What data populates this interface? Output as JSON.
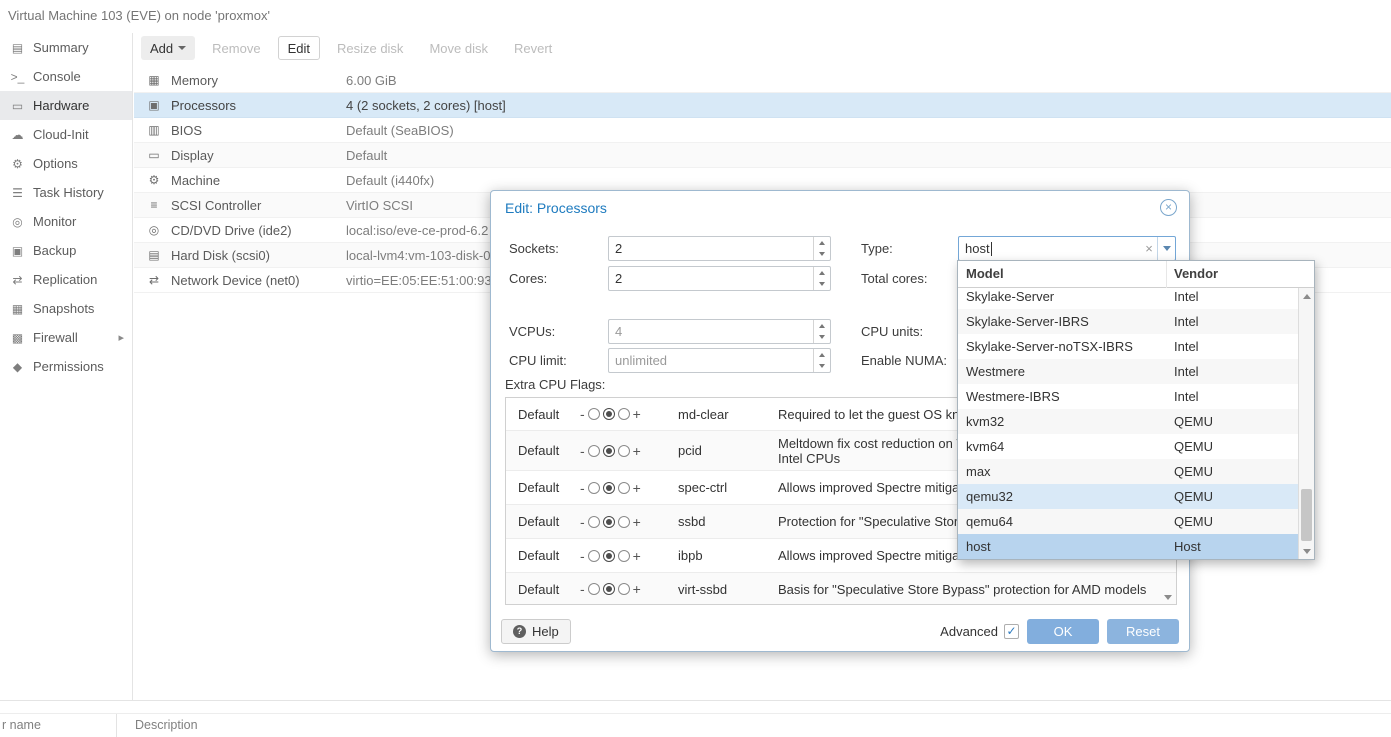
{
  "colors": {
    "accent_blue": "#1e7bbf",
    "row_selected": "#d8e9f7",
    "dropdown_selected": "#b8d4ee",
    "dropdown_hover": "#d9e9f7",
    "button_blue": "#82aedd"
  },
  "icons": {
    "close": "×",
    "clear": "×",
    "help": "?",
    "check": "✓",
    "expander": "▸"
  },
  "window": {
    "title": "Virtual Machine 103 (EVE) on node 'proxmox'"
  },
  "sidebar": {
    "items": [
      {
        "label": "Summary",
        "glyph": "▤"
      },
      {
        "label": "Console",
        "glyph": ">_"
      },
      {
        "label": "Hardware",
        "glyph": "▭"
      },
      {
        "label": "Cloud-Init",
        "glyph": "☁"
      },
      {
        "label": "Options",
        "glyph": "⚙"
      },
      {
        "label": "Task History",
        "glyph": "☰"
      },
      {
        "label": "Monitor",
        "glyph": "◎"
      },
      {
        "label": "Backup",
        "glyph": "▣"
      },
      {
        "label": "Replication",
        "glyph": "⇄"
      },
      {
        "label": "Snapshots",
        "glyph": "▦"
      },
      {
        "label": "Firewall",
        "glyph": "▩"
      },
      {
        "label": "Permissions",
        "glyph": "◆"
      }
    ]
  },
  "toolbar": {
    "buttons": [
      {
        "label": "Add"
      },
      {
        "label": "Remove"
      },
      {
        "label": "Edit"
      },
      {
        "label": "Resize disk"
      },
      {
        "label": "Move disk"
      },
      {
        "label": "Revert"
      }
    ]
  },
  "hardware": {
    "rows": [
      {
        "name": "Memory",
        "value": "6.00 GiB",
        "glyph": "▦"
      },
      {
        "name": "Processors",
        "value": "4 (2 sockets, 2 cores) [host]",
        "glyph": "▣"
      },
      {
        "name": "BIOS",
        "value": "Default (SeaBIOS)",
        "glyph": "▥"
      },
      {
        "name": "Display",
        "value": "Default",
        "glyph": "▭"
      },
      {
        "name": "Machine",
        "value": "Default (i440fx)",
        "glyph": "⚙"
      },
      {
        "name": "SCSI Controller",
        "value": "VirtIO SCSI",
        "glyph": "≡"
      },
      {
        "name": "CD/DVD Drive (ide2)",
        "value": "local:iso/eve-ce-prod-6.2",
        "glyph": "◎"
      },
      {
        "name": "Hard Disk (scsi0)",
        "value": "local-lvm4:vm-103-disk-0",
        "glyph": "▤"
      },
      {
        "name": "Network Device (net0)",
        "value": "virtio=EE:05:EE:51:00:93",
        "glyph": "⇄"
      }
    ]
  },
  "dialog": {
    "title": "Edit: Processors",
    "fields": {
      "sockets": {
        "label": "Sockets:",
        "value": "2"
      },
      "cores": {
        "label": "Cores:",
        "value": "2"
      },
      "type": {
        "label": "Type:",
        "value": "host"
      },
      "total_cores": {
        "label": "Total cores:"
      },
      "vcpus": {
        "label": "VCPUs:",
        "value": "4"
      },
      "cpu_units": {
        "label": "CPU units:"
      },
      "cpu_limit": {
        "label": "CPU limit:",
        "value": "unlimited"
      },
      "enable_numa": {
        "label": "Enable NUMA:"
      }
    },
    "flags_label": "Extra CPU Flags:",
    "flags": [
      {
        "default_label": "Default",
        "flag": "md-clear",
        "desc": "Required to let the guest OS kn"
      },
      {
        "default_label": "Default",
        "flag": "pcid",
        "desc": "Meltdown fix cost reduction on W",
        "desc2": "Intel CPUs"
      },
      {
        "default_label": "Default",
        "flag": "spec-ctrl",
        "desc": "Allows improved Spectre mitiga"
      },
      {
        "default_label": "Default",
        "flag": "ssbd",
        "desc": "Protection for \"Speculative Stor"
      },
      {
        "default_label": "Default",
        "flag": "ibpb",
        "desc": "Allows improved Spectre mitigation with AMD CPUs"
      },
      {
        "default_label": "Default",
        "flag": "virt-ssbd",
        "desc": "Basis for \"Speculative Store Bypass\" protection for AMD models"
      }
    ],
    "footer": {
      "help": "Help",
      "advanced": "Advanced",
      "ok": "OK",
      "reset": "Reset"
    }
  },
  "dropdown": {
    "columns": {
      "model": "Model",
      "vendor": "Vendor"
    },
    "items": [
      {
        "model": "Skylake-Server",
        "vendor": "Intel"
      },
      {
        "model": "Skylake-Server-IBRS",
        "vendor": "Intel"
      },
      {
        "model": "Skylake-Server-noTSX-IBRS",
        "vendor": "Intel"
      },
      {
        "model": "Westmere",
        "vendor": "Intel"
      },
      {
        "model": "Westmere-IBRS",
        "vendor": "Intel"
      },
      {
        "model": "kvm32",
        "vendor": "QEMU"
      },
      {
        "model": "kvm64",
        "vendor": "QEMU"
      },
      {
        "model": "max",
        "vendor": "QEMU"
      },
      {
        "model": "qemu32",
        "vendor": "QEMU"
      },
      {
        "model": "qemu64",
        "vendor": "QEMU"
      },
      {
        "model": "host",
        "vendor": "Host"
      }
    ]
  },
  "log_panel": {
    "user_col": "r name",
    "desc_col": "Description"
  }
}
